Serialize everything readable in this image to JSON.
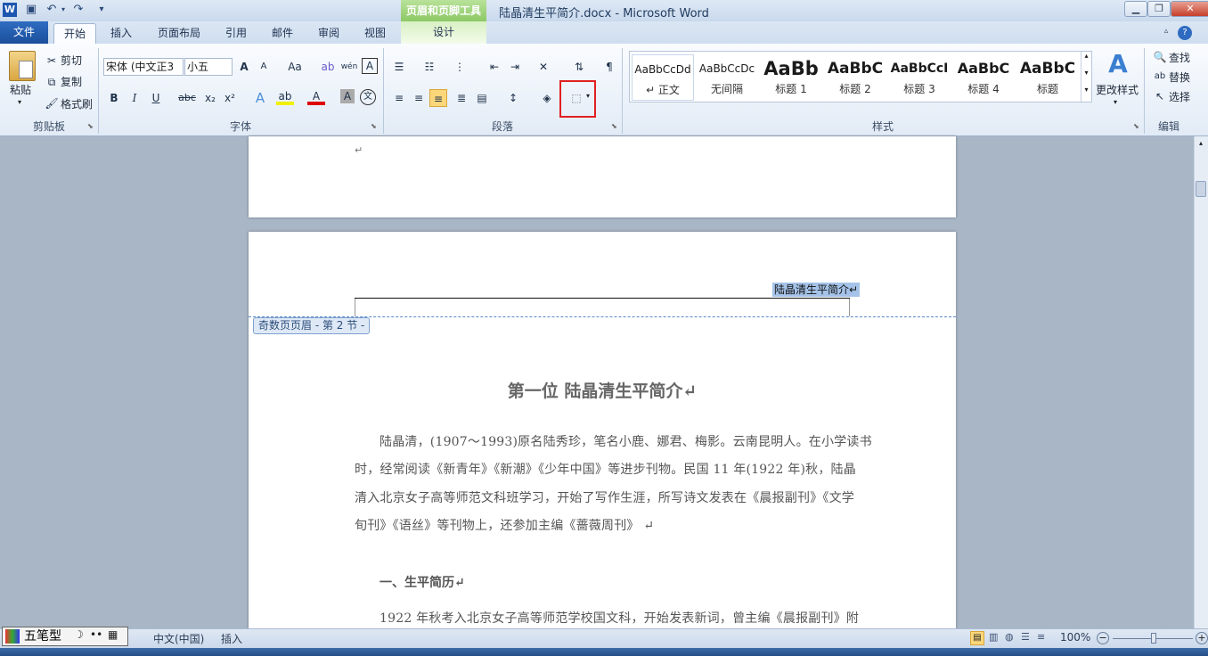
{
  "window": {
    "title": "陆晶清生平简介.docx - Microsoft Word",
    "context_tool": "页眉和页脚工具",
    "app_icon": "W",
    "controls": {
      "minimize": "▁",
      "maximize": "❐",
      "close": "✕"
    }
  },
  "tabs": {
    "file": "文件",
    "home": "开始",
    "insert": "插入",
    "layout": "页面布局",
    "references": "引用",
    "mailings": "邮件",
    "review": "审阅",
    "view": "视图",
    "design": "设计"
  },
  "clipboard": {
    "paste": "粘贴",
    "cut": "剪切",
    "copy": "复制",
    "format_painter": "格式刷",
    "label": "剪贴板"
  },
  "font": {
    "name": "宋体 (中文正3",
    "size": "小五",
    "label": "字体",
    "grow": "A",
    "shrink": "A",
    "case": "Aa",
    "bold": "B",
    "italic": "I",
    "underline": "U",
    "strike": "abc",
    "sub": "x₂",
    "sup": "x²",
    "highlight": "ab",
    "color": "A",
    "shading": "A",
    "phonetic": "文",
    "char_border": "A",
    "wen": "wén"
  },
  "paragraph": {
    "label": "段落"
  },
  "styles": {
    "label": "样式",
    "change": "更改样式",
    "items": [
      {
        "sample": "AaBbCcDd",
        "name": "↵ 正文"
      },
      {
        "sample": "AaBbCcDc",
        "name": "无间隔"
      },
      {
        "sample": "AaBb",
        "name": "标题 1"
      },
      {
        "sample": "AaBbC",
        "name": "标题 2"
      },
      {
        "sample": "AaBbCcI",
        "name": "标题 3"
      },
      {
        "sample": "AaBbC",
        "name": "标题 4"
      },
      {
        "sample": "AaBbC",
        "name": "标题"
      }
    ]
  },
  "editing": {
    "label": "编辑",
    "find": "查找",
    "replace": "替换",
    "select": "选择"
  },
  "document": {
    "para_mark": "↵",
    "header_text": "陆晶清生平简介↵",
    "header_tag": "奇数页页眉 - 第 2 节 -",
    "title": "第一位  陆晶清生平简介↵",
    "paragraph1": [
      "陆晶清，(1907～1993)原名陆秀珍，笔名小鹿、娜君、梅影。云南昆明人。在小学读书",
      "时，经常阅读《新青年》《新潮》《少年中国》等进步刊物。民国 11 年(1922 年)秋，陆晶",
      "清入北京女子高等师范文科班学习，开始了写作生涯，所写诗文发表在《晨报副刊》《文学",
      "旬刊》《语丝》等刊物上，还参加主编《蔷薇周刊》 ↵"
    ],
    "heading1": "一、生平简历↵",
    "paragraph2": "1922 年秋考入北京女子高等师范学校国文科，开始发表新词，曾主编《晨报副刊》附"
  },
  "status": {
    "ime_mode": "五笔型",
    "language": "中文(中国)",
    "insert": "插入",
    "zoom": "100%"
  }
}
